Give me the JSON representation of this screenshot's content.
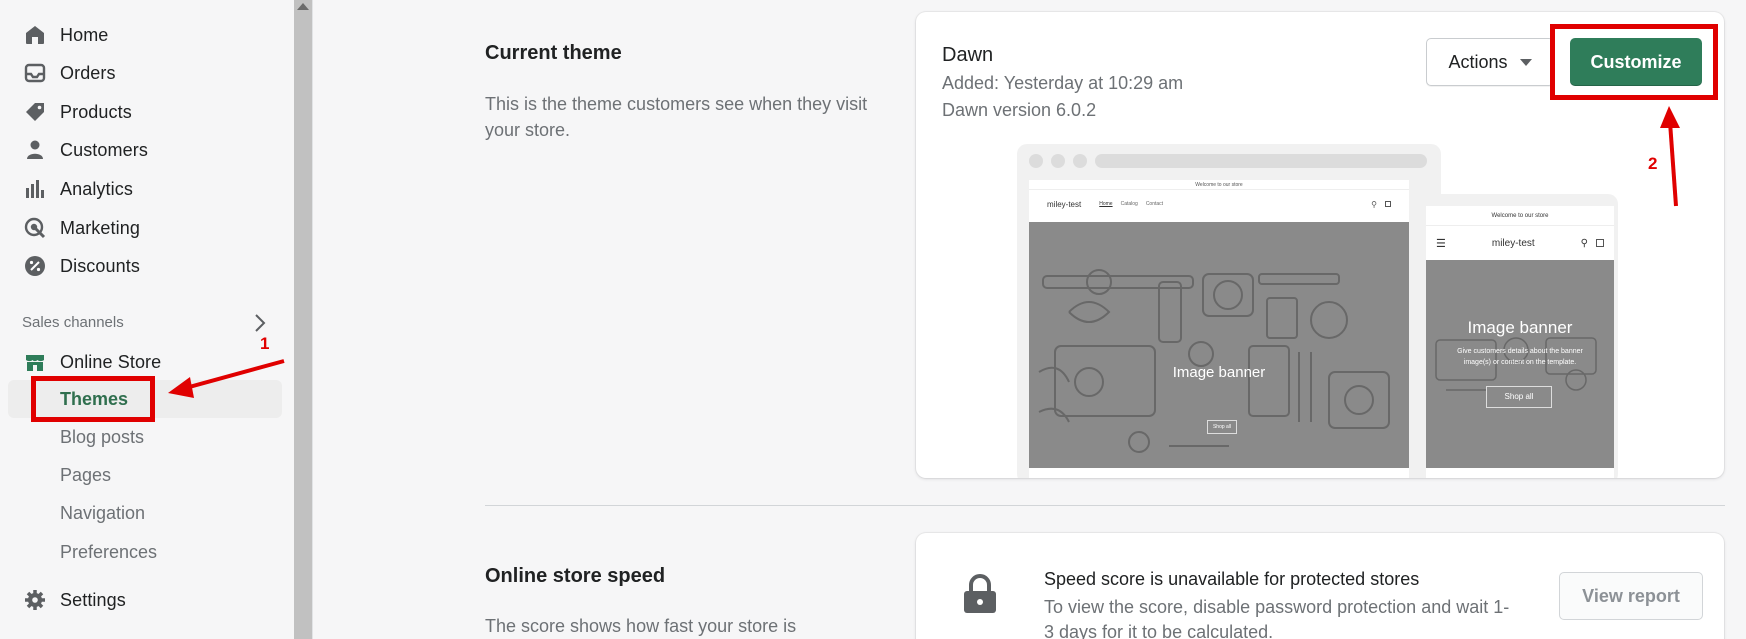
{
  "sidebar": {
    "items": [
      {
        "label": "Home",
        "icon": "home-icon"
      },
      {
        "label": "Orders",
        "icon": "inbox-icon"
      },
      {
        "label": "Products",
        "icon": "tag-icon"
      },
      {
        "label": "Customers",
        "icon": "person-icon"
      },
      {
        "label": "Analytics",
        "icon": "bar-chart-icon"
      },
      {
        "label": "Marketing",
        "icon": "target-icon"
      },
      {
        "label": "Discounts",
        "icon": "percent-badge-icon"
      }
    ],
    "sales_channels_label": "Sales channels",
    "online_store": {
      "label": "Online Store",
      "icon": "store-icon"
    },
    "sub_items": [
      "Themes",
      "Blog posts",
      "Pages",
      "Navigation",
      "Preferences"
    ],
    "settings": {
      "label": "Settings",
      "icon": "gear-icon"
    }
  },
  "current_theme": {
    "section_title": "Current theme",
    "section_desc": "This is the theme customers see when they visit your store.",
    "name": "Dawn",
    "added": "Added: Yesterday at 10:29 am",
    "version": "Dawn version 6.0.2",
    "actions_label": "Actions",
    "customize_label": "Customize",
    "preview": {
      "announcement": "Welcome to our store",
      "store_name": "miley-test",
      "links": [
        "Home",
        "Catalog",
        "Contact"
      ],
      "banner_title": "Image banner",
      "banner_desc_mobile": "Give customers details about the banner image(s) or content on the template.",
      "banner_button": "Shop all"
    }
  },
  "speed": {
    "section_title": "Online store speed",
    "section_desc": "The score shows how fast your store is",
    "card_title": "Speed score is unavailable for protected stores",
    "card_desc": "To view the score, disable password protection and wait 1-3 days for it to be calculated.",
    "report_label": "View report"
  },
  "annotations": {
    "step1": "1",
    "step2": "2"
  },
  "colors": {
    "accent": "#2f7d5a",
    "annotation": "#e00000",
    "active_text": "#2f6f4e"
  }
}
